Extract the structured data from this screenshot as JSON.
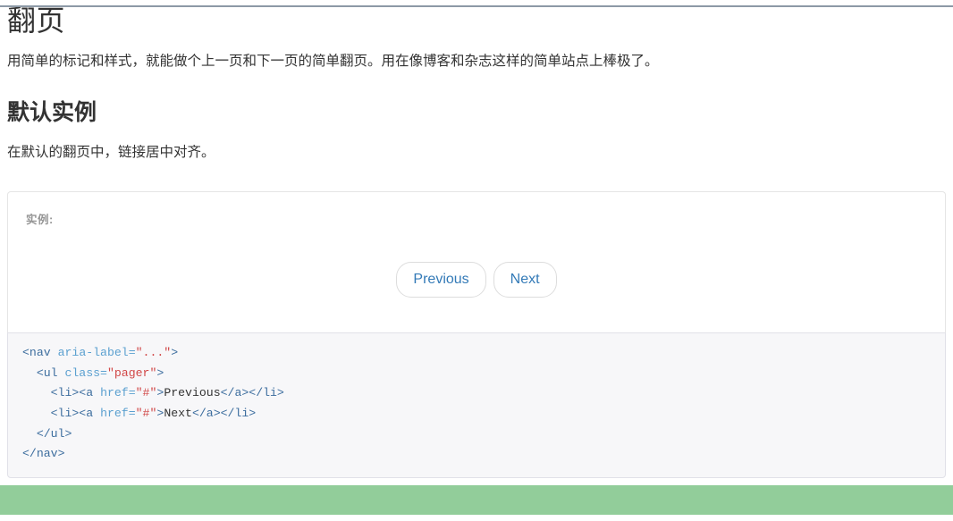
{
  "theme": {
    "top_rule_color": "#8d99a6",
    "link_color": "#337ab7",
    "panel_border_color": "#e5e5e5",
    "code_bg_color": "#f7f7f9",
    "code_border_color": "#e1e1e8",
    "green_bar_color": "#92cd9a",
    "muted_label_color": "#959595",
    "code_tag_color": "#3c6d9e",
    "code_attr_color": "#5ba0d0",
    "code_string_color": "#d14747"
  },
  "page": {
    "title": "翻页",
    "lead": "用简单的标记和样式，就能做个上一页和下一页的简单翻页。用在像博客和杂志这样的简单站点上棒极了。"
  },
  "section": {
    "heading": "默认实例",
    "description": "在默认的翻页中，链接居中对齐。"
  },
  "example": {
    "label": "实例:",
    "pager": {
      "previous_label": "Previous",
      "next_label": "Next"
    }
  },
  "code": {
    "lines": [
      [
        {
          "t": "tag",
          "v": "<nav "
        },
        {
          "t": "attr",
          "v": "aria-label="
        },
        {
          "t": "str",
          "v": "\"...\""
        },
        {
          "t": "tag",
          "v": ">"
        }
      ],
      [
        {
          "t": "plain",
          "v": "  "
        },
        {
          "t": "tag",
          "v": "<ul "
        },
        {
          "t": "attr",
          "v": "class="
        },
        {
          "t": "str",
          "v": "\"pager\""
        },
        {
          "t": "tag",
          "v": ">"
        }
      ],
      [
        {
          "t": "plain",
          "v": "    "
        },
        {
          "t": "tag",
          "v": "<li><a "
        },
        {
          "t": "attr",
          "v": "href="
        },
        {
          "t": "str",
          "v": "\"#\""
        },
        {
          "t": "tag",
          "v": ">"
        },
        {
          "t": "text",
          "v": "Previous"
        },
        {
          "t": "tag",
          "v": "</a></li>"
        }
      ],
      [
        {
          "t": "plain",
          "v": "    "
        },
        {
          "t": "tag",
          "v": "<li><a "
        },
        {
          "t": "attr",
          "v": "href="
        },
        {
          "t": "str",
          "v": "\"#\""
        },
        {
          "t": "tag",
          "v": ">"
        },
        {
          "t": "text",
          "v": "Next"
        },
        {
          "t": "tag",
          "v": "</a></li>"
        }
      ],
      [
        {
          "t": "plain",
          "v": "  "
        },
        {
          "t": "tag",
          "v": "</ul>"
        }
      ],
      [
        {
          "t": "tag",
          "v": "</nav>"
        }
      ]
    ]
  }
}
